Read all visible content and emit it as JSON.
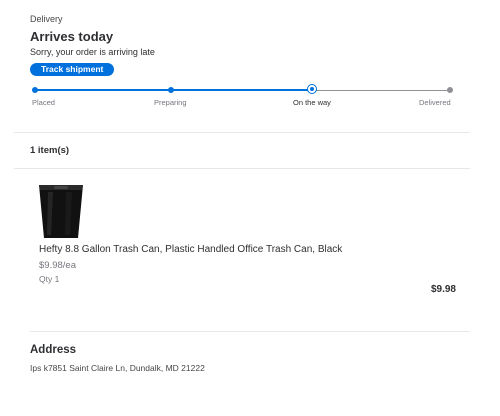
{
  "delivery": {
    "label": "Delivery",
    "title": "Arrives today",
    "message": "Sorry, your order is arriving late",
    "track_label": "Track shipment"
  },
  "progress": {
    "steps": [
      "Placed",
      "Preparing",
      "On the way",
      "Delivered"
    ],
    "current_step": "On the way",
    "accent_color": "#0071dc",
    "inactive_color": "#909196"
  },
  "items": {
    "count_label": "1 item(s)",
    "list": [
      {
        "image_icon": "trash-can-black",
        "name": "Hefty 8.8 Gallon Trash Can, Plastic Handled Office Trash Can, Black",
        "unit_price": "$9.98/ea",
        "qty": "Qty 1",
        "total": "$9.98"
      }
    ]
  },
  "address": {
    "heading": "Address",
    "line": "Ips k7851 Saint Claire Ln, Dundalk, MD 21222"
  }
}
